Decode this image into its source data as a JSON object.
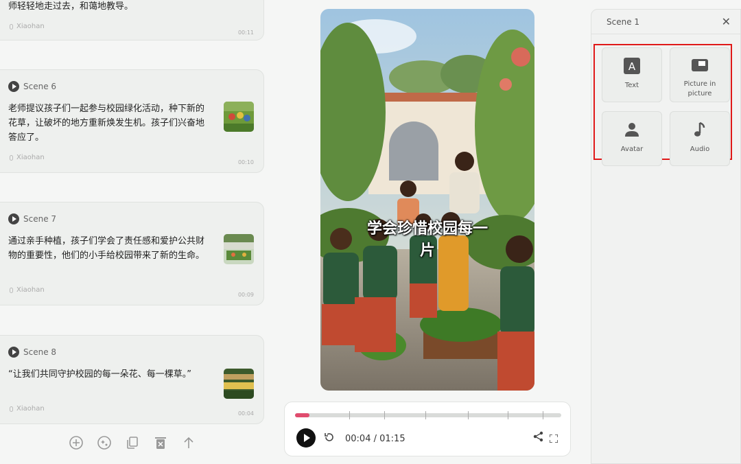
{
  "scenes": [
    {
      "label": "",
      "text": "师轻轻地走过去，和蔼地教导。",
      "voice": "Xiaohan",
      "duration": "00:11"
    },
    {
      "label": "Scene 6",
      "text": "老师提议孩子们一起参与校园绿化活动，种下新的花草，让破坏的地方重新焕发生机。孩子们兴奋地答应了。",
      "voice": "Xiaohan",
      "duration": "00:10"
    },
    {
      "label": "Scene 7",
      "text": "通过亲手种植，孩子们学会了责任感和爱护公共财物的重要性，他们的小手给校园带来了新的生命。",
      "voice": "Xiaohan",
      "duration": "00:09"
    },
    {
      "label": "Scene 8",
      "text": "“让我们共同守护校园的每一朵花、每一棵草。”",
      "voice": "Xiaohan",
      "duration": "00:04"
    }
  ],
  "list_tools": [
    "add-icon",
    "ai-icon",
    "duplicate-icon",
    "delete-icon",
    "move-up-icon"
  ],
  "video": {
    "caption": "学会珍惜校园每一片"
  },
  "player": {
    "current_time": "00:04",
    "separator": " / ",
    "total_time": "01:15",
    "progress": 0.055,
    "accent": "#e04c6e"
  },
  "panel": {
    "title": "Scene 1",
    "tiles": [
      {
        "label": "Text",
        "icon": "text-icon"
      },
      {
        "label": "Picture in picture",
        "icon": "picture-in-picture-icon"
      },
      {
        "label": "Avatar",
        "icon": "avatar-icon"
      },
      {
        "label": "Audio",
        "icon": "audio-icon"
      }
    ],
    "highlight_color": "#e01818"
  }
}
